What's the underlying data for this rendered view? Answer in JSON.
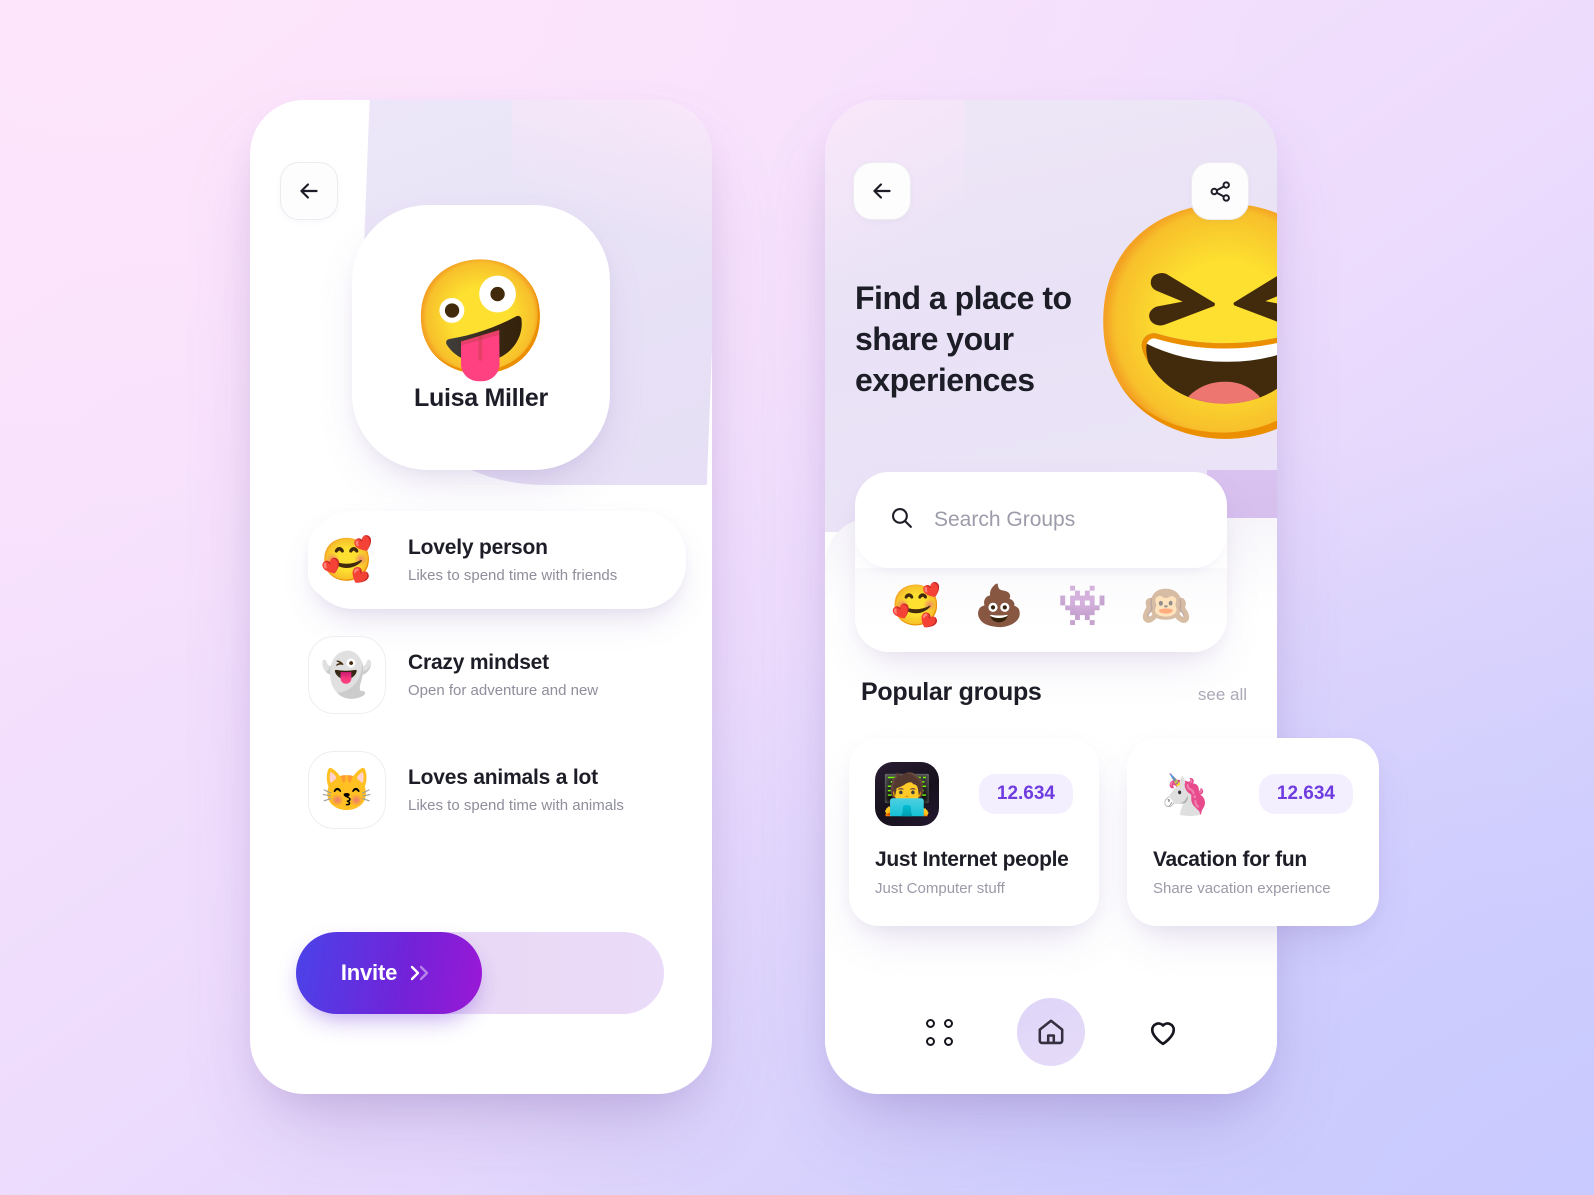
{
  "theme": {
    "accent_purple": "#7c3aed",
    "badge_bg": "#f4efff",
    "gradient_start": "#fbe4fd",
    "gradient_mid": "#eedcfd",
    "gradient_end": "#cbcbfc",
    "invite_gradient_from": "#4a43e8",
    "invite_gradient_to": "#9b18d6"
  },
  "profile_screen": {
    "back_button": {
      "icon": "arrow-left-icon"
    },
    "profile": {
      "avatar_emoji": "🤪",
      "name": "Luisa Miller"
    },
    "traits": [
      {
        "icon": "🥰",
        "icon_name": "smiling-face-with-hearts-icon",
        "title": "Lovely person",
        "subtitle": "Likes to spend time with friends",
        "active": true
      },
      {
        "icon": "👻",
        "icon_name": "ghost-icon",
        "title": "Crazy mindset",
        "subtitle": "Open for adventure and new",
        "active": false
      },
      {
        "icon": "😽",
        "icon_name": "kissing-cat-icon",
        "title": "Loves animals a lot",
        "subtitle": "Likes to spend time with animals",
        "active": false
      }
    ],
    "invite": {
      "label": "Invite",
      "chevrons": "››"
    }
  },
  "groups_screen": {
    "back_button": {
      "icon": "arrow-left-icon"
    },
    "share_button": {
      "icon": "share-icon"
    },
    "hero": {
      "title": "Find a place to share your experiences",
      "memoji": "😆"
    },
    "search": {
      "icon": "search-icon",
      "placeholder": "Search Groups",
      "value": ""
    },
    "emoji_filters": [
      {
        "emoji": "🥰",
        "name": "smiling-face-with-hearts-filter"
      },
      {
        "emoji": "💩",
        "name": "pile-of-poo-filter"
      },
      {
        "emoji": "👾",
        "name": "alien-monster-filter"
      },
      {
        "emoji": "🙉",
        "name": "hear-no-evil-monkey-filter"
      }
    ],
    "section": {
      "title": "Popular groups",
      "see_all": "see all"
    },
    "groups": [
      {
        "avatar_emoji": "🧑‍💻",
        "avatar_name": "technologist-avatar",
        "count": "12.634",
        "name": "Just Internet people",
        "subtitle": "Just Computer stuff"
      },
      {
        "avatar_emoji": "🦄",
        "avatar_name": "unicorn-avatar",
        "count": "12.634",
        "name": "Vacation for fun",
        "subtitle": "Share vacation experience"
      }
    ],
    "nav": [
      {
        "name": "grid",
        "label": "",
        "active": false
      },
      {
        "name": "home",
        "label": "",
        "active": true
      },
      {
        "name": "favorites",
        "label": "",
        "active": false
      }
    ]
  }
}
